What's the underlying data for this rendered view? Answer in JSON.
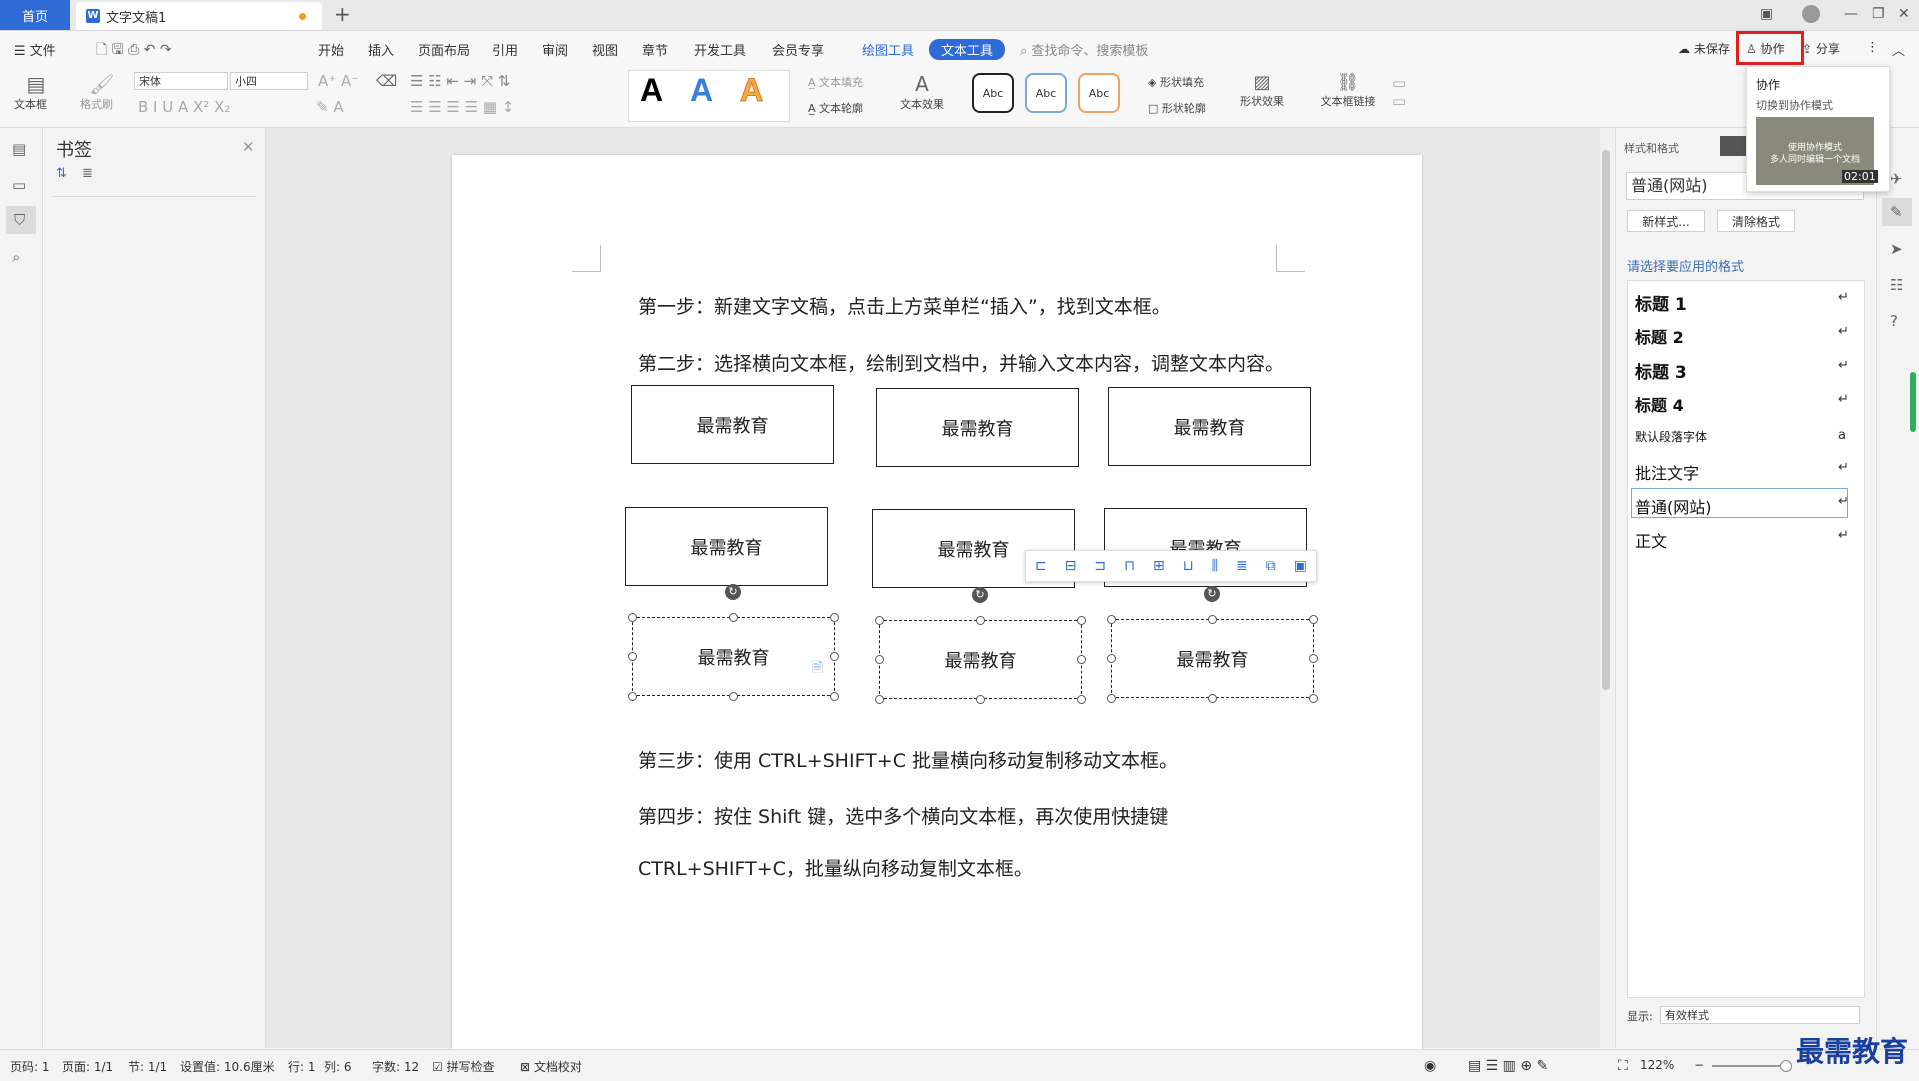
{
  "titlebar": {
    "home": "首页",
    "doc_tab": "文字文稿1",
    "new_tab": "+"
  },
  "menu": {
    "file": "文件",
    "items": [
      "开始",
      "插入",
      "页面布局",
      "引用",
      "审阅",
      "视图",
      "章节",
      "开发工具",
      "会员专享"
    ],
    "draw_tool": "绘图工具",
    "text_tool": "文本工具",
    "search_placeholder": "查找命令、搜索模板",
    "unsaved": "未保存",
    "collab": "协作",
    "share": "分享"
  },
  "ribbon": {
    "textbox": "文本框",
    "format_painter": "格式刷",
    "font": "宋体",
    "size": "小四",
    "text_fill": "文本填充",
    "text_outline": "文本轮廓",
    "text_effect": "文本效果",
    "shape_fill": "形状填充",
    "shape_outline": "形状轮廓",
    "shape_effect": "形状效果",
    "textbox_link": "文本框链接",
    "abc": "Abc",
    "big_a": "A"
  },
  "bookmark": {
    "title": "书签"
  },
  "document": {
    "step1": "第一步：新建文字文稿，点击上方菜单栏“插入”，找到文本框。",
    "step2": "第二步：选择横向文本框，绘制到文档中，并输入文本内容，调整文本内容。",
    "box_text": "最需教育",
    "step3": "第三步：使用 CTRL+SHIFT+C 批量横向移动复制移动文本框。",
    "step4a": "第四步：按住 Shift 键，选中多个横向文本框，再次使用快捷键",
    "step4b": "CTRL+SHIFT+C，批量纵向移动复制文本框。"
  },
  "popup": {
    "title": "协作",
    "subtitle": "切换到协作模式",
    "thumb_line1": "使用协作模式",
    "thumb_line2": "多人同时编辑一个文档",
    "duration": "02:01"
  },
  "style_panel": {
    "header": "样式和格式",
    "current": "普通(网站)",
    "new_style": "新样式...",
    "clear_format": "清除格式",
    "choose_label": "请选择要应用的格式",
    "styles": [
      "标题 1",
      "标题 2",
      "标题 3",
      "标题 4",
      "默认段落字体",
      "批注文字",
      "普通(网站)",
      "正文"
    ],
    "show_label": "显示:",
    "show_value": "有效样式"
  },
  "status": {
    "page_num": "页码: 1",
    "pages": "页面: 1/1",
    "section": "节: 1/1",
    "setting": "设置值: 10.6厘米",
    "row": "行: 1",
    "col": "列: 6",
    "words": "字数: 12",
    "spell": "拼写检查",
    "proof": "文档校对",
    "zoom": "122%"
  },
  "watermark": "最需教育"
}
